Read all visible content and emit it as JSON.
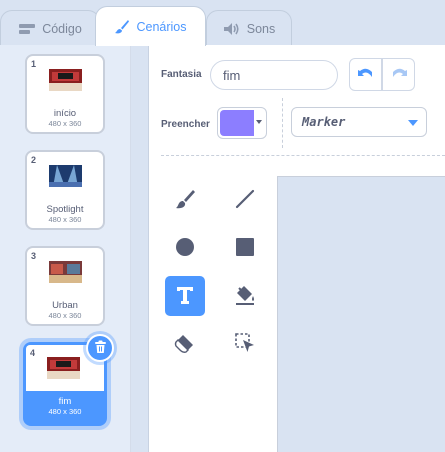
{
  "tabs": [
    {
      "label": "Código",
      "icon": "code-icon"
    },
    {
      "label": "Cenários",
      "icon": "brush-icon"
    },
    {
      "label": "Sons",
      "icon": "speaker-icon"
    }
  ],
  "costumes": [
    {
      "number": "1",
      "name": "início",
      "size": "480 x 360"
    },
    {
      "number": "2",
      "name": "Spotlight",
      "size": "480 x 360"
    },
    {
      "number": "3",
      "name": "Urban",
      "size": "480 x 360"
    },
    {
      "number": "4",
      "name": "fim",
      "size": "480 x 360",
      "selected": true
    }
  ],
  "editor": {
    "costume_label": "Fantasia",
    "costume_name": "fim",
    "fill_label": "Preencher",
    "fill_color": "#8c7eff",
    "font": "Marker"
  },
  "tools": [
    "brush-icon",
    "line-icon",
    "circle-icon",
    "rectangle-icon",
    "text-icon",
    "fill-icon",
    "eraser-icon",
    "select-icon"
  ],
  "colors": {
    "accent": "#4c97ff",
    "tool_gray": "#575e75",
    "canvas": "#d9e3f2"
  }
}
